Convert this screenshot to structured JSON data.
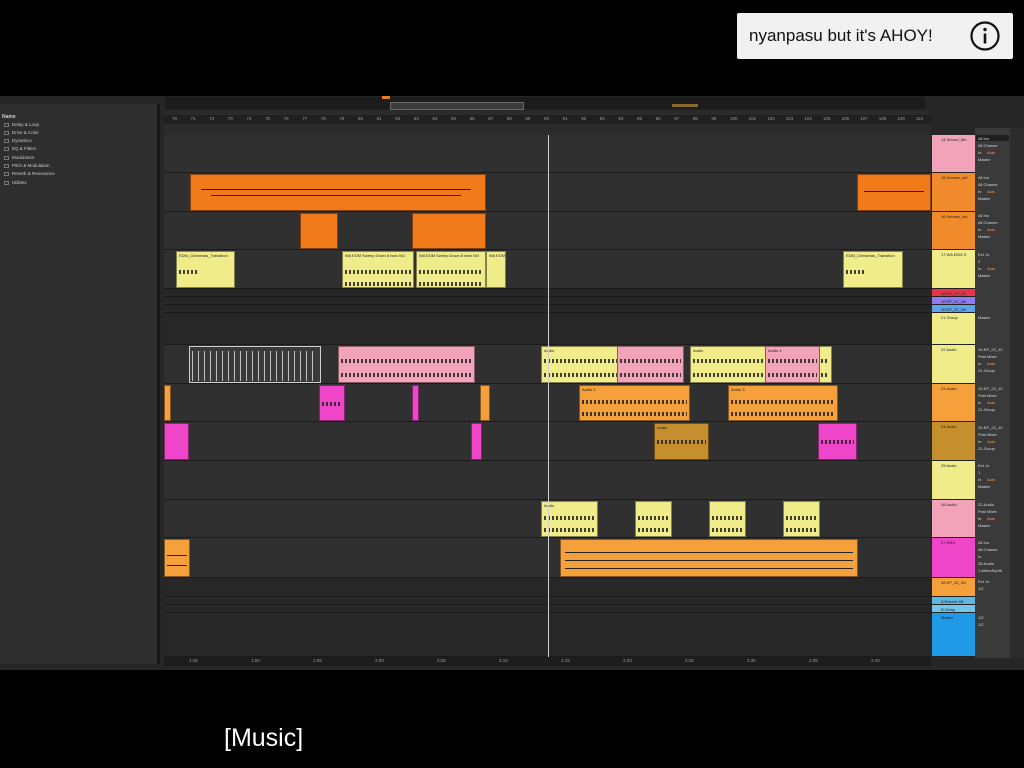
{
  "video": {
    "title": "nyanpasu but it's AHOY!",
    "subtitle": "[Music]"
  },
  "browser": {
    "title": "Name",
    "items": [
      "Delay & Loop",
      "Drive & Color",
      "Dynamics",
      "EQ & Filters",
      "Modulators",
      "Pitch & Modulation",
      "Reverb & Resonance",
      "Utilities"
    ]
  },
  "ruler": {
    "bars": [
      "70",
      "71",
      "72",
      "73",
      "74",
      "75",
      "76",
      "77",
      "78",
      "79",
      "80",
      "81",
      "82",
      "83",
      "84",
      "85",
      "86",
      "87",
      "88",
      "89",
      "90",
      "91",
      "92",
      "93",
      "94",
      "95",
      "96",
      "97",
      "98",
      "99",
      "100",
      "101",
      "102",
      "103",
      "104",
      "105",
      "106",
      "107",
      "108",
      "109",
      "110"
    ],
    "times": [
      "1:45",
      "1:50",
      "1:55",
      "2:00",
      "2:05",
      "2:10",
      "2:15",
      "2:20",
      "2:25",
      "2:30",
      "2:35",
      "2:40"
    ]
  },
  "tracks": [
    {
      "label": "14 Shovel_8th",
      "color": "#f2a3b9"
    },
    {
      "label": "15 Senses_ukt",
      "color": "#f18a2b"
    },
    {
      "label": "16 Senses_ukt",
      "color": "#f18a2b"
    },
    {
      "label": "17 WA EDM S",
      "color": "#f0ec8a"
    },
    {
      "label": "18 EP_CT_10",
      "color": "#e8334a"
    },
    {
      "label": "19 EP_22_ldh",
      "color": "#8e7cf0"
    },
    {
      "label": "20 EP_22_Hit",
      "color": "#5fa3e8"
    },
    {
      "label": "21 Group",
      "color": "#f0ec8a"
    },
    {
      "label": "22 Audio",
      "color": "#f0ec8a"
    },
    {
      "label": "23 Audio",
      "color": "#f5a03a"
    },
    {
      "label": "24 Audio",
      "color": "#c58f2e"
    },
    {
      "label": "25 Audio",
      "color": "#f0ec8a"
    },
    {
      "label": "26 Audio",
      "color": "#f2a3b9"
    },
    {
      "label": "27 MIDI",
      "color": "#ef45c8"
    },
    {
      "label": "28 EP_22_Str",
      "color": "#f5a03a"
    },
    {
      "label": "A Reverb Hit",
      "color": "#5fb7e0"
    },
    {
      "label": "B Delay",
      "color": "#71c6ea"
    },
    {
      "label": "Master",
      "color": "#1f9ae6"
    }
  ],
  "clips": {
    "transition_a": "EDM_Christmas_Transition",
    "sweep_a": "WA EDM Sweep Down 8 bars NO",
    "sweep_b": "WA EDM Sweep Down 8 bars NO",
    "sweep_c": "WA EDM",
    "transition_b": "EDM_Christmas_Transition",
    "audio": "Audio",
    "audio_2": "Audio 2",
    "audio_3": "Audio 3",
    "audio_4": "Audio 4"
  },
  "io": {
    "all_ins": "All Ins",
    "all_channels": "All Channe",
    "in": "In",
    "auto": "Auto",
    "off": "Off",
    "master": "Master",
    "ext_in": "Ext. In",
    "post_mixer": "Post Mixer",
    "group_21": "21-Group",
    "channel_1": "1",
    "channel_2": "2",
    "ch_12": "1/2",
    "src_ep1": "19-EP_22_10",
    "src_ep2": "20-EP_22_10",
    "src_audio": "22-Audio",
    "src_midi": "28-Audio",
    "synth": "1-MetroSynth",
    "value": "-inf"
  }
}
